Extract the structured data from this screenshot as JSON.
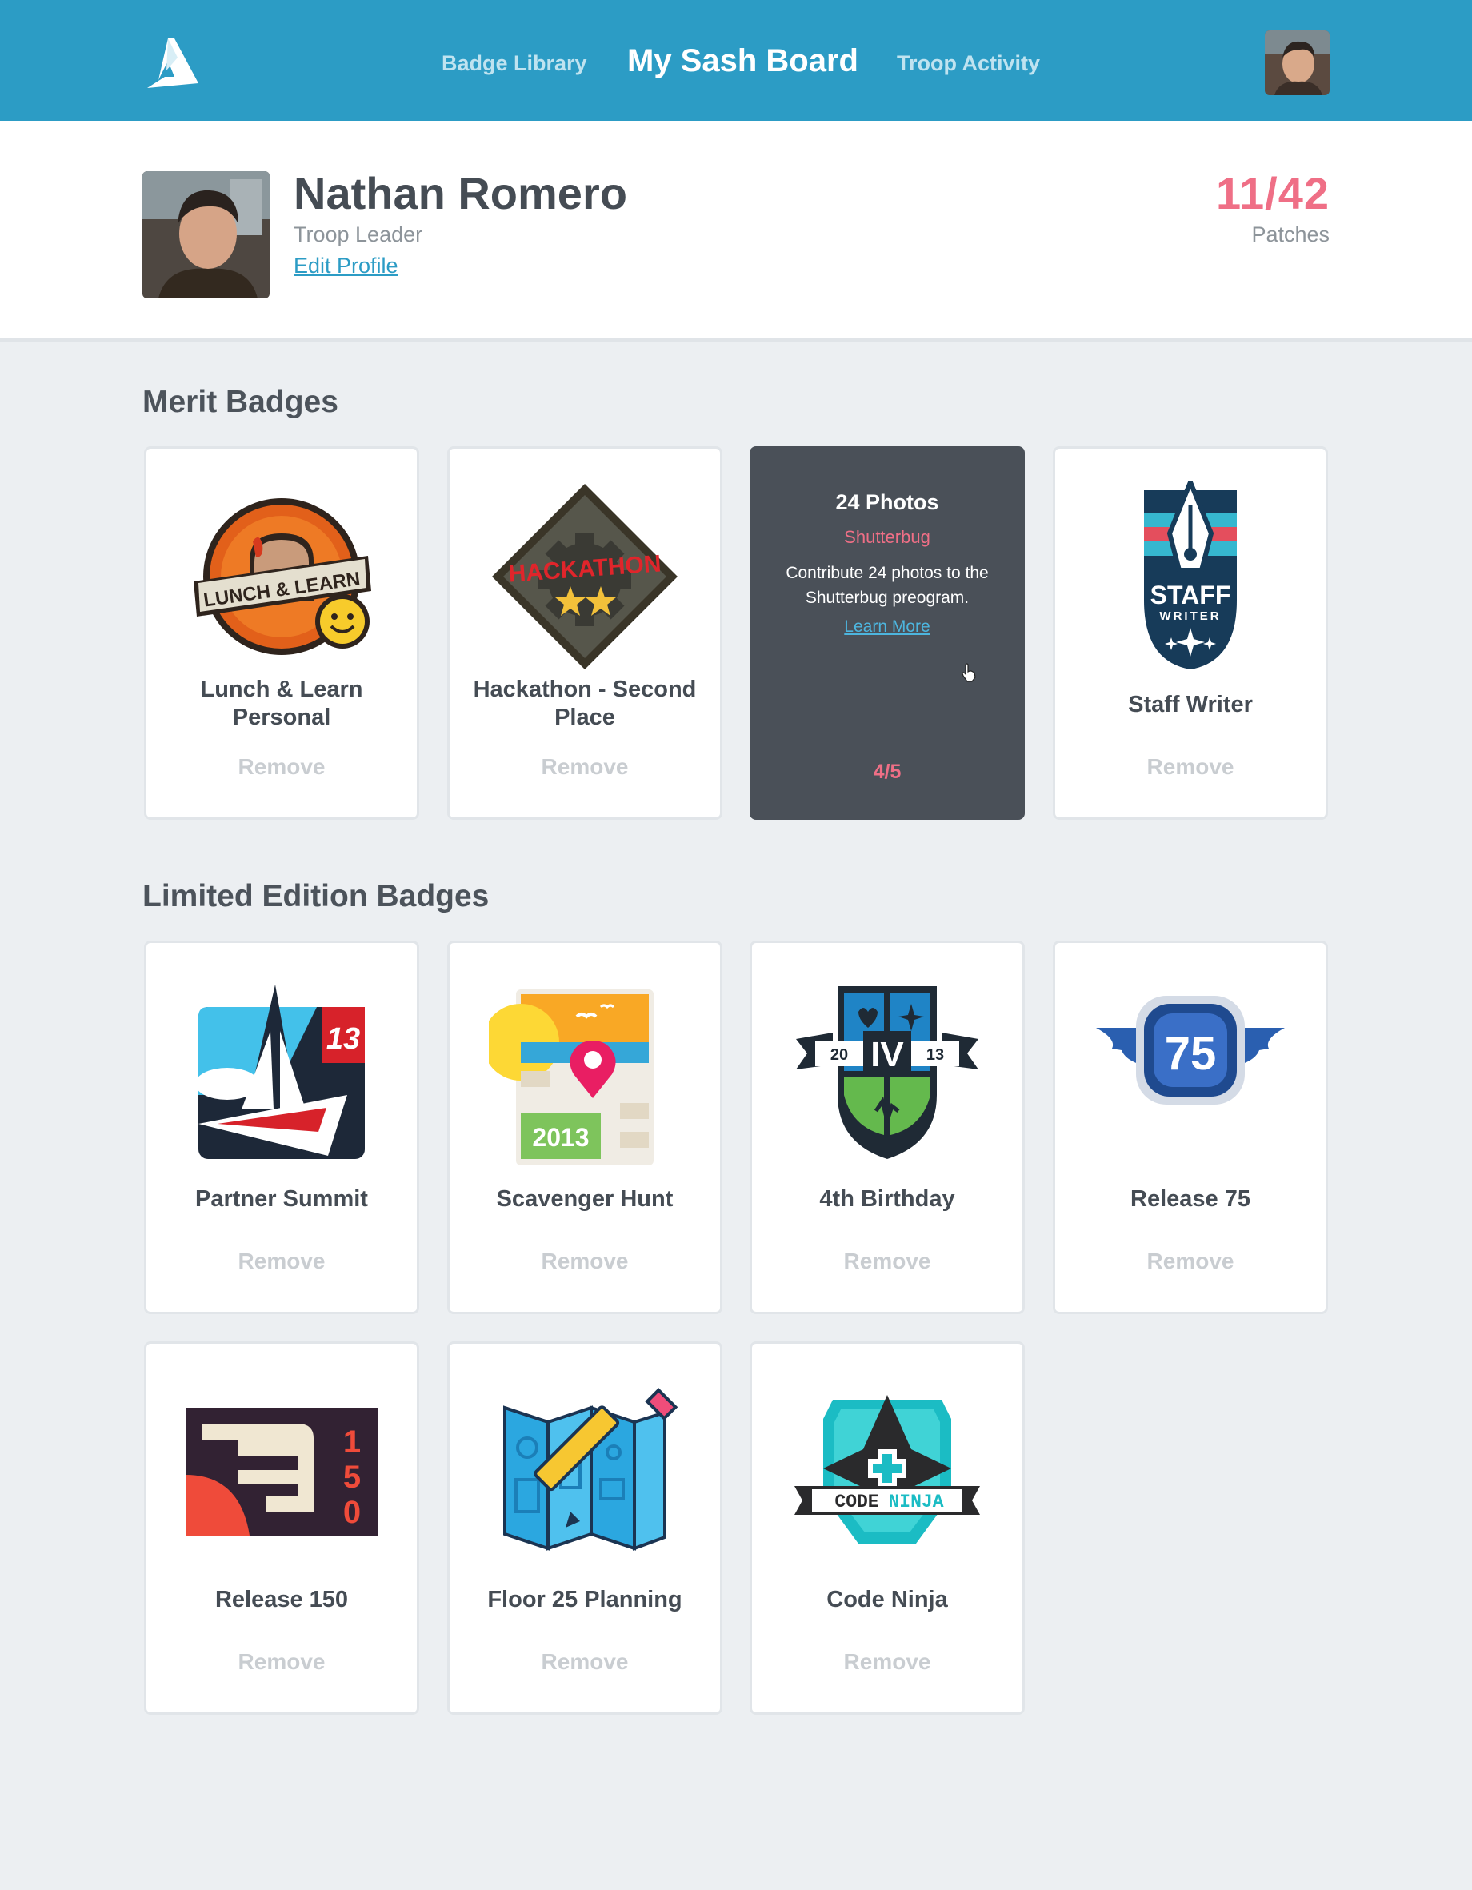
{
  "nav": {
    "library": "Badge Library",
    "sash": "My Sash Board",
    "activity": "Troop Activity"
  },
  "profile": {
    "name": "Nathan Romero",
    "role": "Troop Leader",
    "edit": "Edit Profile",
    "count": "11/42",
    "count_label": "Patches"
  },
  "merit": {
    "heading": "Merit Badges",
    "cards": [
      {
        "title": "Lunch & Learn Personal",
        "action": "Remove",
        "icon": "lunch-learn-icon"
      },
      {
        "title": "Hackathon - Second Place",
        "action": "Remove",
        "icon": "hackathon-icon"
      },
      {
        "hover_title": "24 Photos",
        "hover_sub": "Shutterbug",
        "hover_desc": "Contribute 24 photos to the Shutterbug preogram.",
        "hover_link": "Learn More",
        "progress": "4/5"
      },
      {
        "title": "Staff Writer",
        "action": "Remove",
        "icon": "staff-writer-icon"
      }
    ]
  },
  "limited": {
    "heading": "Limited Edition Badges",
    "cards": [
      {
        "title": "Partner Summit",
        "action": "Remove",
        "icon": "partner-summit-icon"
      },
      {
        "title": "Scavenger Hunt",
        "action": "Remove",
        "icon": "scavenger-hunt-icon"
      },
      {
        "title": "4th Birthday",
        "action": "Remove",
        "icon": "birthday-icon"
      },
      {
        "title": "Release 75",
        "action": "Remove",
        "icon": "release-75-icon"
      },
      {
        "title": "Release 150",
        "action": "Remove",
        "icon": "release-150-icon"
      },
      {
        "title": "Floor 25 Planning",
        "action": "Remove",
        "icon": "floor-planning-icon"
      },
      {
        "title": "Code Ninja",
        "action": "Remove",
        "icon": "code-ninja-icon"
      }
    ]
  },
  "badge_text": {
    "lunch": "LUNCH & LEARN",
    "hack": "HACKATHON",
    "staff": "STAFF",
    "writer": "WRITER",
    "summit_num": "13",
    "hunt_year": "2013",
    "bday_roman": "IV",
    "bday_left": "20",
    "bday_right": "13",
    "rel75": "75",
    "rel150_1": "1",
    "rel150_5": "5",
    "rel150_0": "0",
    "ninja_code": "CODE",
    "ninja_ninja": "NINJA"
  },
  "colors": {
    "header": "#2c9cc5",
    "accent_pink": "#ef6f86",
    "hover_card": "#4a5058"
  }
}
